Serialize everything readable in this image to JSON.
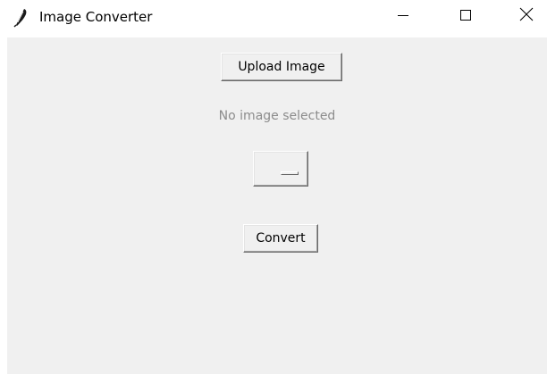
{
  "window": {
    "title": "Image Converter",
    "app_icon": "feather-icon",
    "controls": {
      "minimize_icon": "minimize-icon",
      "maximize_icon": "maximize-icon",
      "close_icon": "close-icon"
    }
  },
  "main": {
    "upload_button_label": "Upload Image",
    "status_text": "No image selected",
    "format_menu_value": "",
    "convert_button_label": "Convert"
  },
  "colors": {
    "client_background": "#f0f0f0",
    "titlebar_background": "#ffffff",
    "status_text": "#8c8c8c"
  }
}
